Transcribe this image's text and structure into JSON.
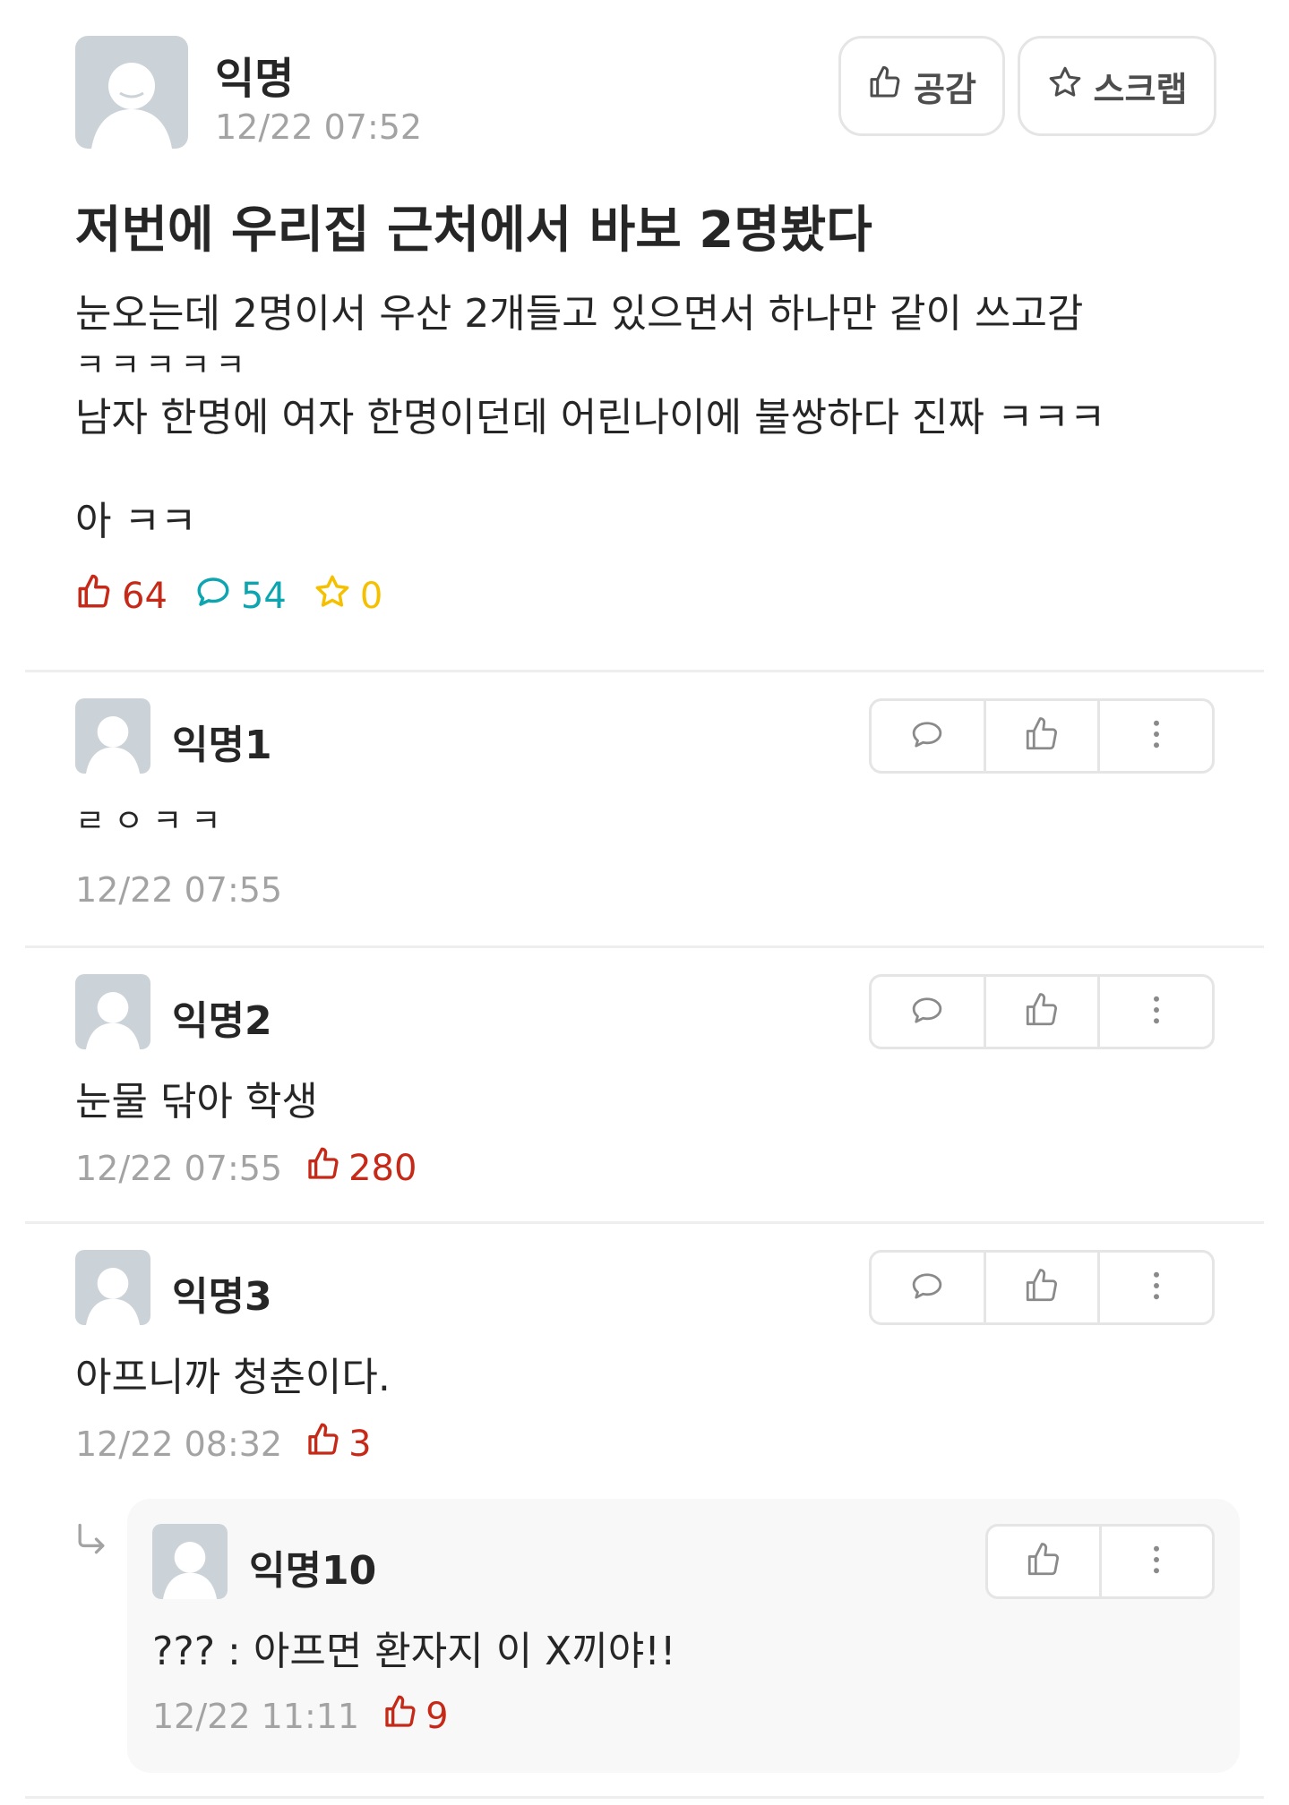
{
  "post": {
    "author": "익명",
    "time": "12/22 07:52",
    "like_button": "공감",
    "scrap_button": "스크랩",
    "title": "저번에 우리집 근처에서 바보 2명봤다",
    "body_line1": "눈오는데 2명이서 우산 2개들고 있으면서 하나만 같이 쓰고감",
    "body_line2": "ㅋㅋㅋㅋㅋ",
    "body_line3": "남자 한명에 여자 한명이던데 어린나이에 불쌍하다 진짜 ㅋㅋㅋ",
    "body_line4": "",
    "body_line5": "아 ㅋㅋ",
    "stats": {
      "likes": "64",
      "comments": "54",
      "scraps": "0"
    }
  },
  "comments": [
    {
      "author": "익명1",
      "text": "ㄹㅇㅋㅋ",
      "time": "12/22 07:55",
      "likes": ""
    },
    {
      "author": "익명2",
      "text": "눈물 닦아 학생",
      "time": "12/22 07:55",
      "likes": "280"
    },
    {
      "author": "익명3",
      "text": "아프니까 청춘이다.",
      "time": "12/22 08:32",
      "likes": "3"
    }
  ],
  "reply": {
    "author": "익명10",
    "text": "??? : 아프면 환자지 이 X끼야!!",
    "time": "12/22 11:11",
    "likes": "9"
  },
  "icons": {
    "thumb": "thumbs-up-icon",
    "star": "star-icon",
    "comment": "speech-bubble-icon",
    "more": "more-vertical-icon",
    "reply_arrow": "reply-arrow-icon"
  },
  "colors": {
    "like": "#c62917",
    "comment": "#0ca5b0",
    "scrap": "#f5c000",
    "muted": "#a3a3a3",
    "avatar": "#ccd3d8"
  }
}
